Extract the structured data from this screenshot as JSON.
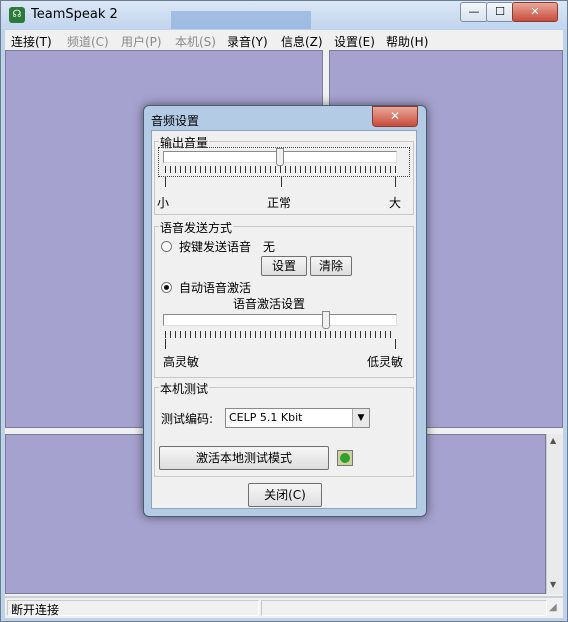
{
  "window": {
    "title": "TeamSpeak 2",
    "min": "—",
    "max": "☐",
    "close": "✕"
  },
  "menu": [
    {
      "label": "连接(T)",
      "enabled": true
    },
    {
      "label": "频道(C)",
      "enabled": false
    },
    {
      "label": "用户(P)",
      "enabled": false
    },
    {
      "label": "本机(S)",
      "enabled": false
    },
    {
      "label": "录音(Y)",
      "enabled": true
    },
    {
      "label": "信息(Z)",
      "enabled": true
    },
    {
      "label": "设置(E)",
      "enabled": true
    },
    {
      "label": "帮助(H)",
      "enabled": true
    }
  ],
  "status": {
    "connection": "断开连接"
  },
  "dialog": {
    "title": "音频设置",
    "close": "✕",
    "output": {
      "group": "输出音量",
      "level": 0.5,
      "min_label": "小",
      "mid_label": "正常",
      "max_label": "大"
    },
    "voice": {
      "group": "语音发送方式",
      "ptt_label": "按键发送语音",
      "ptt_key": "无",
      "ptt_selected": false,
      "set_button": "设置",
      "clear_button": "清除",
      "va_label": "自动语音激活",
      "va_selected": true,
      "va_slider_title": "语音激活设置",
      "va_level": 0.7,
      "high_label": "高灵敏",
      "low_label": "低灵敏"
    },
    "test": {
      "group": "本机测试",
      "codec_label": "测试编码:",
      "codec_value": "CELP 5.1 Kbit",
      "activate_button": "激活本地测试模式"
    },
    "close_button": "关闭(C)"
  },
  "colors": {
    "pane": "#a5a2cf",
    "frame": "#b4cbe6",
    "led": "#2ea12e"
  }
}
